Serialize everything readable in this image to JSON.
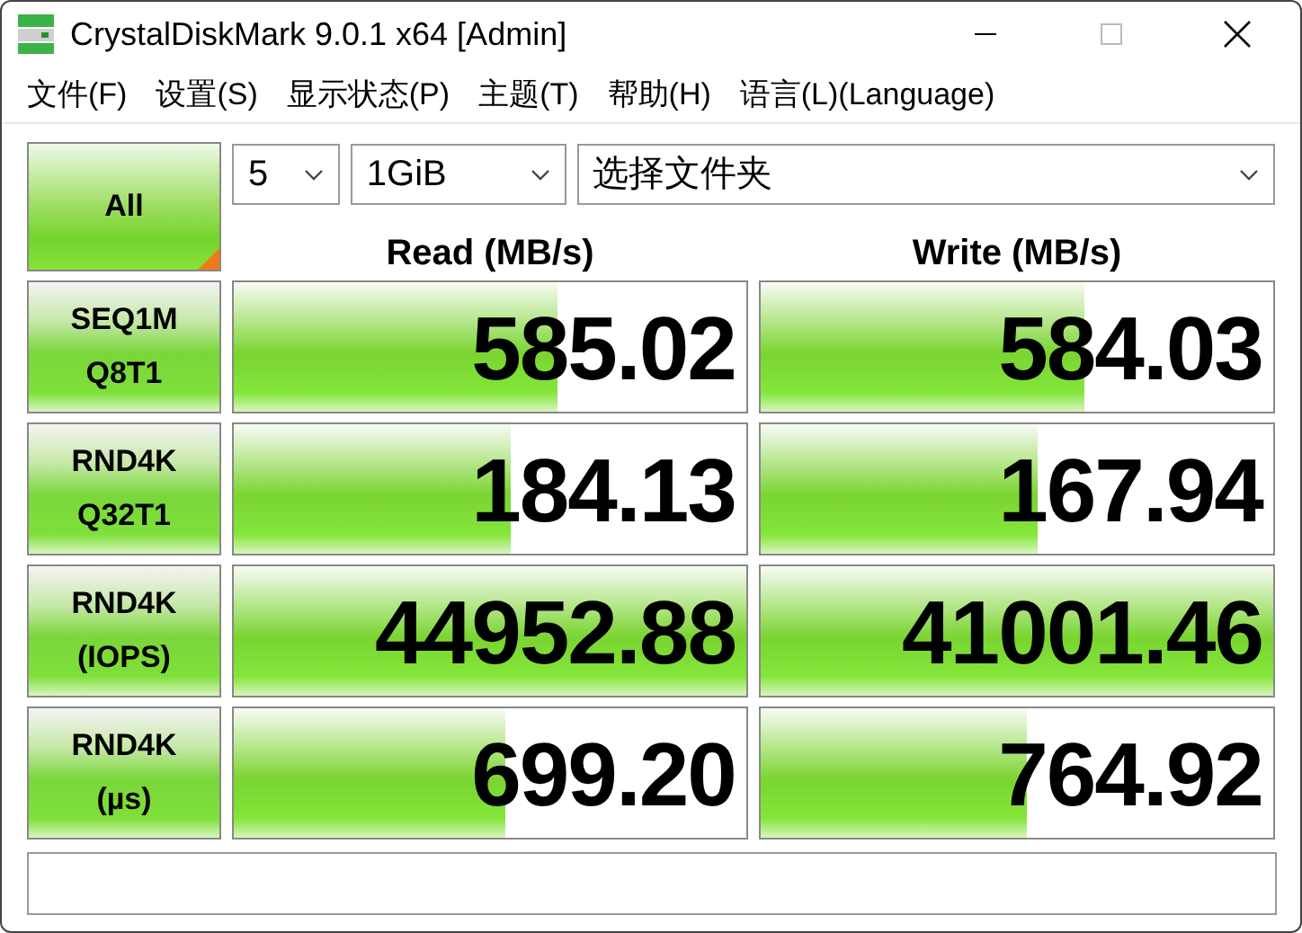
{
  "window": {
    "title": "CrystalDiskMark 9.0.1 x64 [Admin]"
  },
  "menu": [
    "文件(F)",
    "设置(S)",
    "显示状态(P)",
    "主题(T)",
    "帮助(H)",
    "语言(L)(Language)"
  ],
  "all_button": {
    "label": "All"
  },
  "selects": [
    {
      "value": "5"
    },
    {
      "value": "1GiB"
    },
    {
      "value": "选择文件夹"
    }
  ],
  "headers": {
    "read": "Read (MB/s)",
    "write": "Write (MB/s)"
  },
  "tests": [
    {
      "label": [
        "SEQ1M",
        "Q8T1"
      ],
      "read": {
        "value": "585.02",
        "level": 0.63
      },
      "write": {
        "value": "584.03",
        "level": 0.63
      }
    },
    {
      "label": [
        "RND4K",
        "Q32T1"
      ],
      "read": {
        "value": "184.13",
        "level": 0.54
      },
      "write": {
        "value": "167.94",
        "level": 0.54
      }
    },
    {
      "label": [
        "RND4K",
        "(IOPS)"
      ],
      "read": {
        "value": "44952.88",
        "level": 1
      },
      "write": {
        "value": "41001.46",
        "level": 1
      }
    },
    {
      "label": [
        "RND4K",
        "(µs)"
      ],
      "read": {
        "value": "699.20",
        "level": 0.53
      },
      "write": {
        "value": "764.92",
        "level": 0.52
      }
    }
  ]
}
